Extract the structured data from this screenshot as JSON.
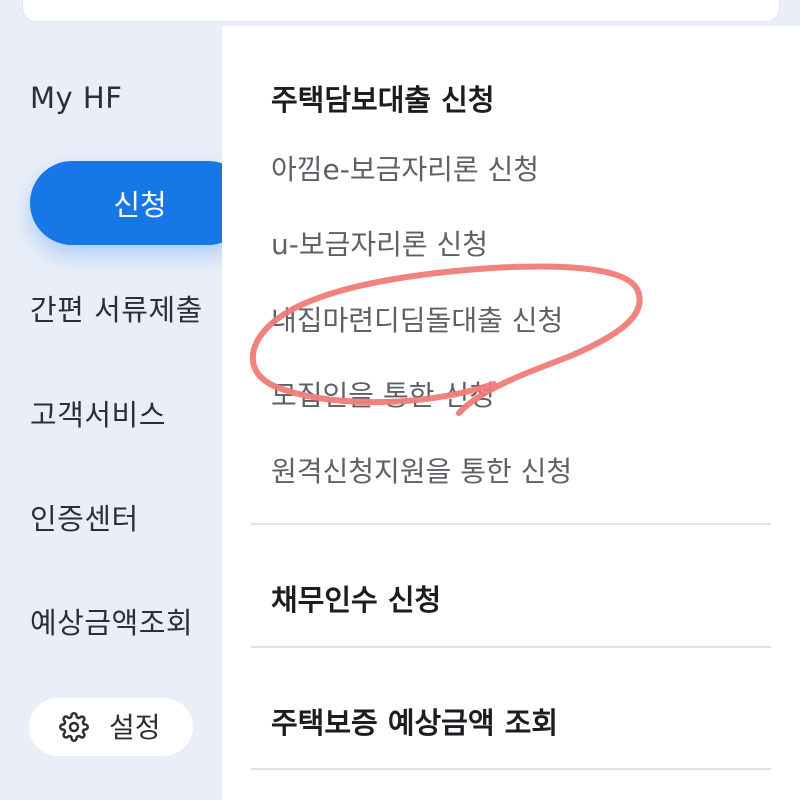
{
  "sidebar": {
    "items": [
      {
        "label": "My HF"
      },
      {
        "label": "신청"
      },
      {
        "label": "간편 서류제출"
      },
      {
        "label": "고객서비스"
      },
      {
        "label": "인증센터"
      },
      {
        "label": "예상금액조회"
      }
    ],
    "settings_label": "설정",
    "settings_icon": "gear-icon",
    "active_color": "#1877e6",
    "background_color": "#e9eef8"
  },
  "main": {
    "sections": [
      {
        "title": "주택담보대출 신청",
        "items": [
          {
            "label": "아낌e-보금자리론 신청"
          },
          {
            "label": "u-보금자리론 신청"
          },
          {
            "label": "내집마련디딤돌대출 신청"
          },
          {
            "label": "모집인을 통한 신청"
          },
          {
            "label": "원격신청지원을 통한 신청"
          }
        ]
      },
      {
        "title": "채무인수 신청"
      },
      {
        "title": "주택보증 예상금액 조회"
      }
    ]
  },
  "annotation": {
    "shape": "hand-drawn-circle",
    "color": "#f07b76"
  }
}
